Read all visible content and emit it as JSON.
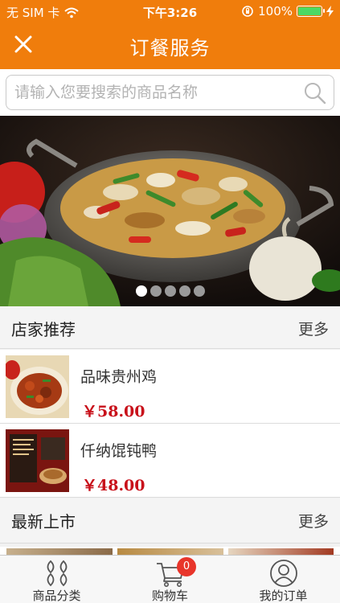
{
  "status_bar": {
    "carrier": "无 SIM 卡",
    "time": "下午3:26",
    "battery_percent": "100%",
    "battery_level": 1.0
  },
  "nav": {
    "title": "订餐服务",
    "close_icon": "close-icon"
  },
  "search": {
    "placeholder": "请输入您要搜索的商品名称",
    "value": ""
  },
  "banner": {
    "slide_count": 5,
    "active_index": 0
  },
  "sections": {
    "recommended": {
      "title": "店家推荐",
      "more": "更多",
      "items": [
        {
          "name": "品味贵州鸡",
          "price": "￥58.00"
        },
        {
          "name": "仟纳馄钝鸭",
          "price": "￥48.00"
        }
      ]
    },
    "new_arrivals": {
      "title": "最新上市",
      "more": "更多"
    }
  },
  "tab_bar": {
    "items": [
      {
        "label": "商品分类",
        "icon": "grid-icon"
      },
      {
        "label": "购物车",
        "icon": "cart-icon",
        "badge": "0"
      },
      {
        "label": "我的订单",
        "icon": "user-icon"
      }
    ]
  },
  "colors": {
    "brand": "#f07d0c",
    "price": "#c8101a",
    "badge": "#e8352b"
  }
}
